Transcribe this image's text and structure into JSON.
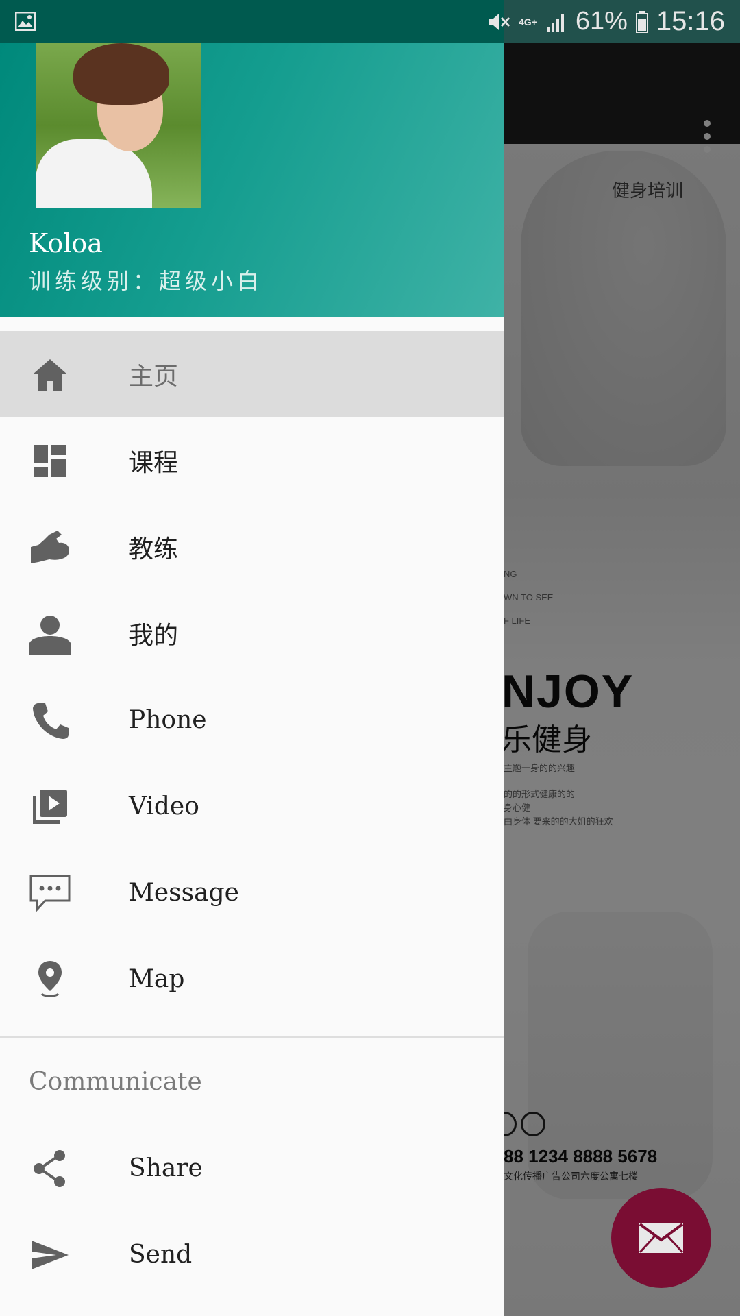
{
  "status_bar": {
    "network": "4G+",
    "battery": "61%",
    "time": "15:16"
  },
  "drawer": {
    "user": {
      "name": "Koloa",
      "level": "训练级别：超级小白"
    },
    "items": [
      {
        "label": "主页",
        "icon": "home-icon",
        "active": true
      },
      {
        "label": "课程",
        "icon": "dashboard-icon"
      },
      {
        "label": "教练",
        "icon": "arm-muscle-icon"
      },
      {
        "label": "我的",
        "icon": "person-icon"
      },
      {
        "label": "Phone",
        "icon": "phone-icon"
      },
      {
        "label": "Video",
        "icon": "video-library-icon"
      },
      {
        "label": "Message",
        "icon": "message-icon"
      },
      {
        "label": "Map",
        "icon": "location-pin-icon"
      }
    ],
    "section_title": "Communicate",
    "section_items": [
      {
        "label": "Share",
        "icon": "share-icon"
      },
      {
        "label": "Send",
        "icon": "send-icon"
      }
    ]
  },
  "background": {
    "header_text": "健身培训",
    "poster_headline": "NJOY",
    "poster_subtitle": "乐健身",
    "poster_small": [
      "NG",
      "WN TO SEE",
      "F LIFE",
      "主题一身的的兴趣",
      "的的形式健康的的",
      "身心健",
      "由身体  要来的的大姐的狂欢"
    ],
    "poster_phone": "88 1234  8888 5678",
    "poster_address": "文化传播广告公司六度公寓七楼"
  },
  "colors": {
    "accent": "#00897b",
    "fab": "#7a0d33",
    "toolbar": "#212121"
  }
}
